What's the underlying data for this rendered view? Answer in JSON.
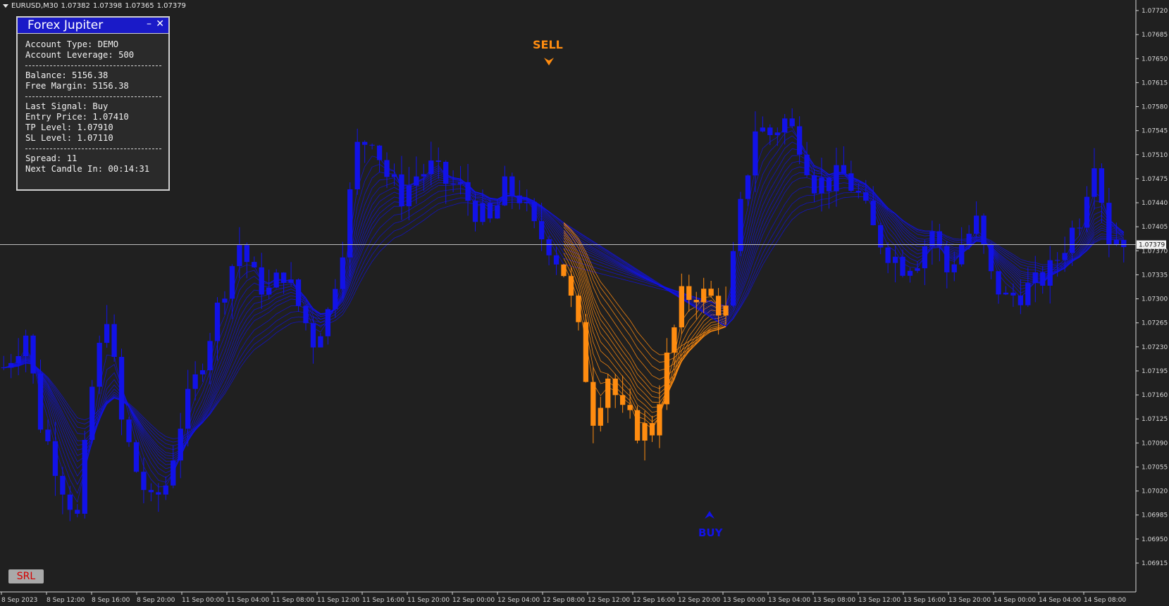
{
  "header": {
    "symbol": "EURUSD,M30",
    "bid": "1.07382",
    "high": "1.07398",
    "low": "1.07365",
    "close": "1.07379"
  },
  "panel": {
    "title": "Forex Jupiter",
    "minimize_label": "–",
    "close_label": "✕",
    "account_type": "Account Type: DEMO",
    "leverage": "Account Leverage: 500",
    "balance": "Balance: 5156.38",
    "free_margin": "Free Margin: 5156.38",
    "last_signal": "Last Signal: Buy",
    "entry_price": "Entry Price: 1.07410",
    "tp_level": "TP Level: 1.07910",
    "sl_level": "SL Level: 1.07110",
    "spread": "Spread: 11",
    "next_candle": "Next Candle In: 00:14:31"
  },
  "signals": {
    "sell_label": "SELL",
    "buy_label": "BUY"
  },
  "srl_button_label": "SRL",
  "colors": {
    "background": "#202020",
    "bull": "#1212e8",
    "bear_signal": "#ff8c10",
    "axis_text": "#d8d8d8",
    "current_price_line": "#bdbdbd",
    "panel_title_bg": "#1a1ac8",
    "srl_text": "#d40000"
  },
  "chart_data": {
    "type": "candlestick",
    "y_ticks": [
      "1.07720",
      "1.07685",
      "1.07650",
      "1.07615",
      "1.07580",
      "1.07545",
      "1.07510",
      "1.07475",
      "1.07440",
      "1.07405",
      "1.07370",
      "1.07335",
      "1.07300",
      "1.07265",
      "1.07230",
      "1.07195",
      "1.07160",
      "1.07125",
      "1.07090",
      "1.07055",
      "1.07020",
      "1.06985",
      "1.06950",
      "1.06915"
    ],
    "x_ticks": [
      "8 Sep 2023",
      "8 Sep 12:00",
      "8 Sep 16:00",
      "8 Sep 20:00",
      "11 Sep 00:00",
      "11 Sep 04:00",
      "11 Sep 08:00",
      "11 Sep 12:00",
      "11 Sep 16:00",
      "11 Sep 20:00",
      "12 Sep 00:00",
      "12 Sep 04:00",
      "12 Sep 08:00",
      "12 Sep 12:00",
      "12 Sep 16:00",
      "12 Sep 20:00",
      "13 Sep 00:00",
      "13 Sep 04:00",
      "13 Sep 08:00",
      "13 Sep 12:00",
      "13 Sep 16:00",
      "13 Sep 20:00",
      "14 Sep 00:00",
      "14 Sep 04:00",
      "14 Sep 08:00"
    ],
    "current_price": "1.07379",
    "ylim": [
      1.069,
      1.0774
    ],
    "close_path": [
      [
        0,
        1.072
      ],
      [
        3,
        1.0725
      ],
      [
        5,
        1.0712
      ],
      [
        8,
        1.0703
      ],
      [
        10,
        1.0698
      ],
      [
        12,
        1.0717
      ],
      [
        14,
        1.0728
      ],
      [
        16,
        1.0712
      ],
      [
        18,
        1.0705
      ],
      [
        20,
        1.07
      ],
      [
        22,
        1.0703
      ],
      [
        24,
        1.0712
      ],
      [
        26,
        1.0718
      ],
      [
        28,
        1.0725
      ],
      [
        30,
        1.0732
      ],
      [
        32,
        1.0738
      ],
      [
        34,
        1.0733
      ],
      [
        36,
        1.0731
      ],
      [
        38,
        1.0734
      ],
      [
        40,
        1.0729
      ],
      [
        42,
        1.0724
      ],
      [
        44,
        1.0728
      ],
      [
        46,
        1.0738
      ],
      [
        48,
        1.0752
      ],
      [
        50,
        1.0754
      ],
      [
        52,
        1.0748
      ],
      [
        54,
        1.0745
      ],
      [
        56,
        1.0748
      ],
      [
        58,
        1.0749
      ],
      [
        60,
        1.0747
      ],
      [
        62,
        1.0746
      ],
      [
        64,
        1.0743
      ],
      [
        66,
        1.0741
      ],
      [
        68,
        1.0746
      ],
      [
        70,
        1.0745
      ],
      [
        72,
        1.074
      ],
      [
        74,
        1.0738
      ],
      [
        76,
        1.0734
      ],
      [
        78,
        1.0725
      ],
      [
        80,
        1.0713
      ],
      [
        82,
        1.0719
      ],
      [
        84,
        1.0713
      ],
      [
        86,
        1.0711
      ],
      [
        88,
        1.0711
      ],
      [
        90,
        1.0721
      ],
      [
        92,
        1.073
      ],
      [
        94,
        1.0731
      ],
      [
        96,
        1.073
      ],
      [
        98,
        1.0728
      ],
      [
        100,
        1.0743
      ],
      [
        102,
        1.0755
      ],
      [
        104,
        1.0754
      ],
      [
        106,
        1.0756
      ],
      [
        108,
        1.0753
      ],
      [
        110,
        1.0747
      ],
      [
        112,
        1.0747
      ],
      [
        114,
        1.0748
      ],
      [
        116,
        1.0745
      ],
      [
        118,
        1.074
      ],
      [
        120,
        1.0737
      ],
      [
        122,
        1.0735
      ],
      [
        124,
        1.0736
      ],
      [
        126,
        1.074
      ],
      [
        128,
        1.0734
      ],
      [
        130,
        1.0738
      ],
      [
        132,
        1.0741
      ],
      [
        134,
        1.0733
      ],
      [
        136,
        1.073
      ],
      [
        138,
        1.0731
      ],
      [
        140,
        1.0732
      ],
      [
        142,
        1.0734
      ],
      [
        144,
        1.0738
      ],
      [
        146,
        1.0742
      ],
      [
        148,
        1.0751
      ],
      [
        150,
        1.0739
      ],
      [
        152,
        1.0739
      ]
    ],
    "sell_signal_near": "12 Sep 08:00",
    "buy_signal_near": "12 Sep 20:00"
  }
}
